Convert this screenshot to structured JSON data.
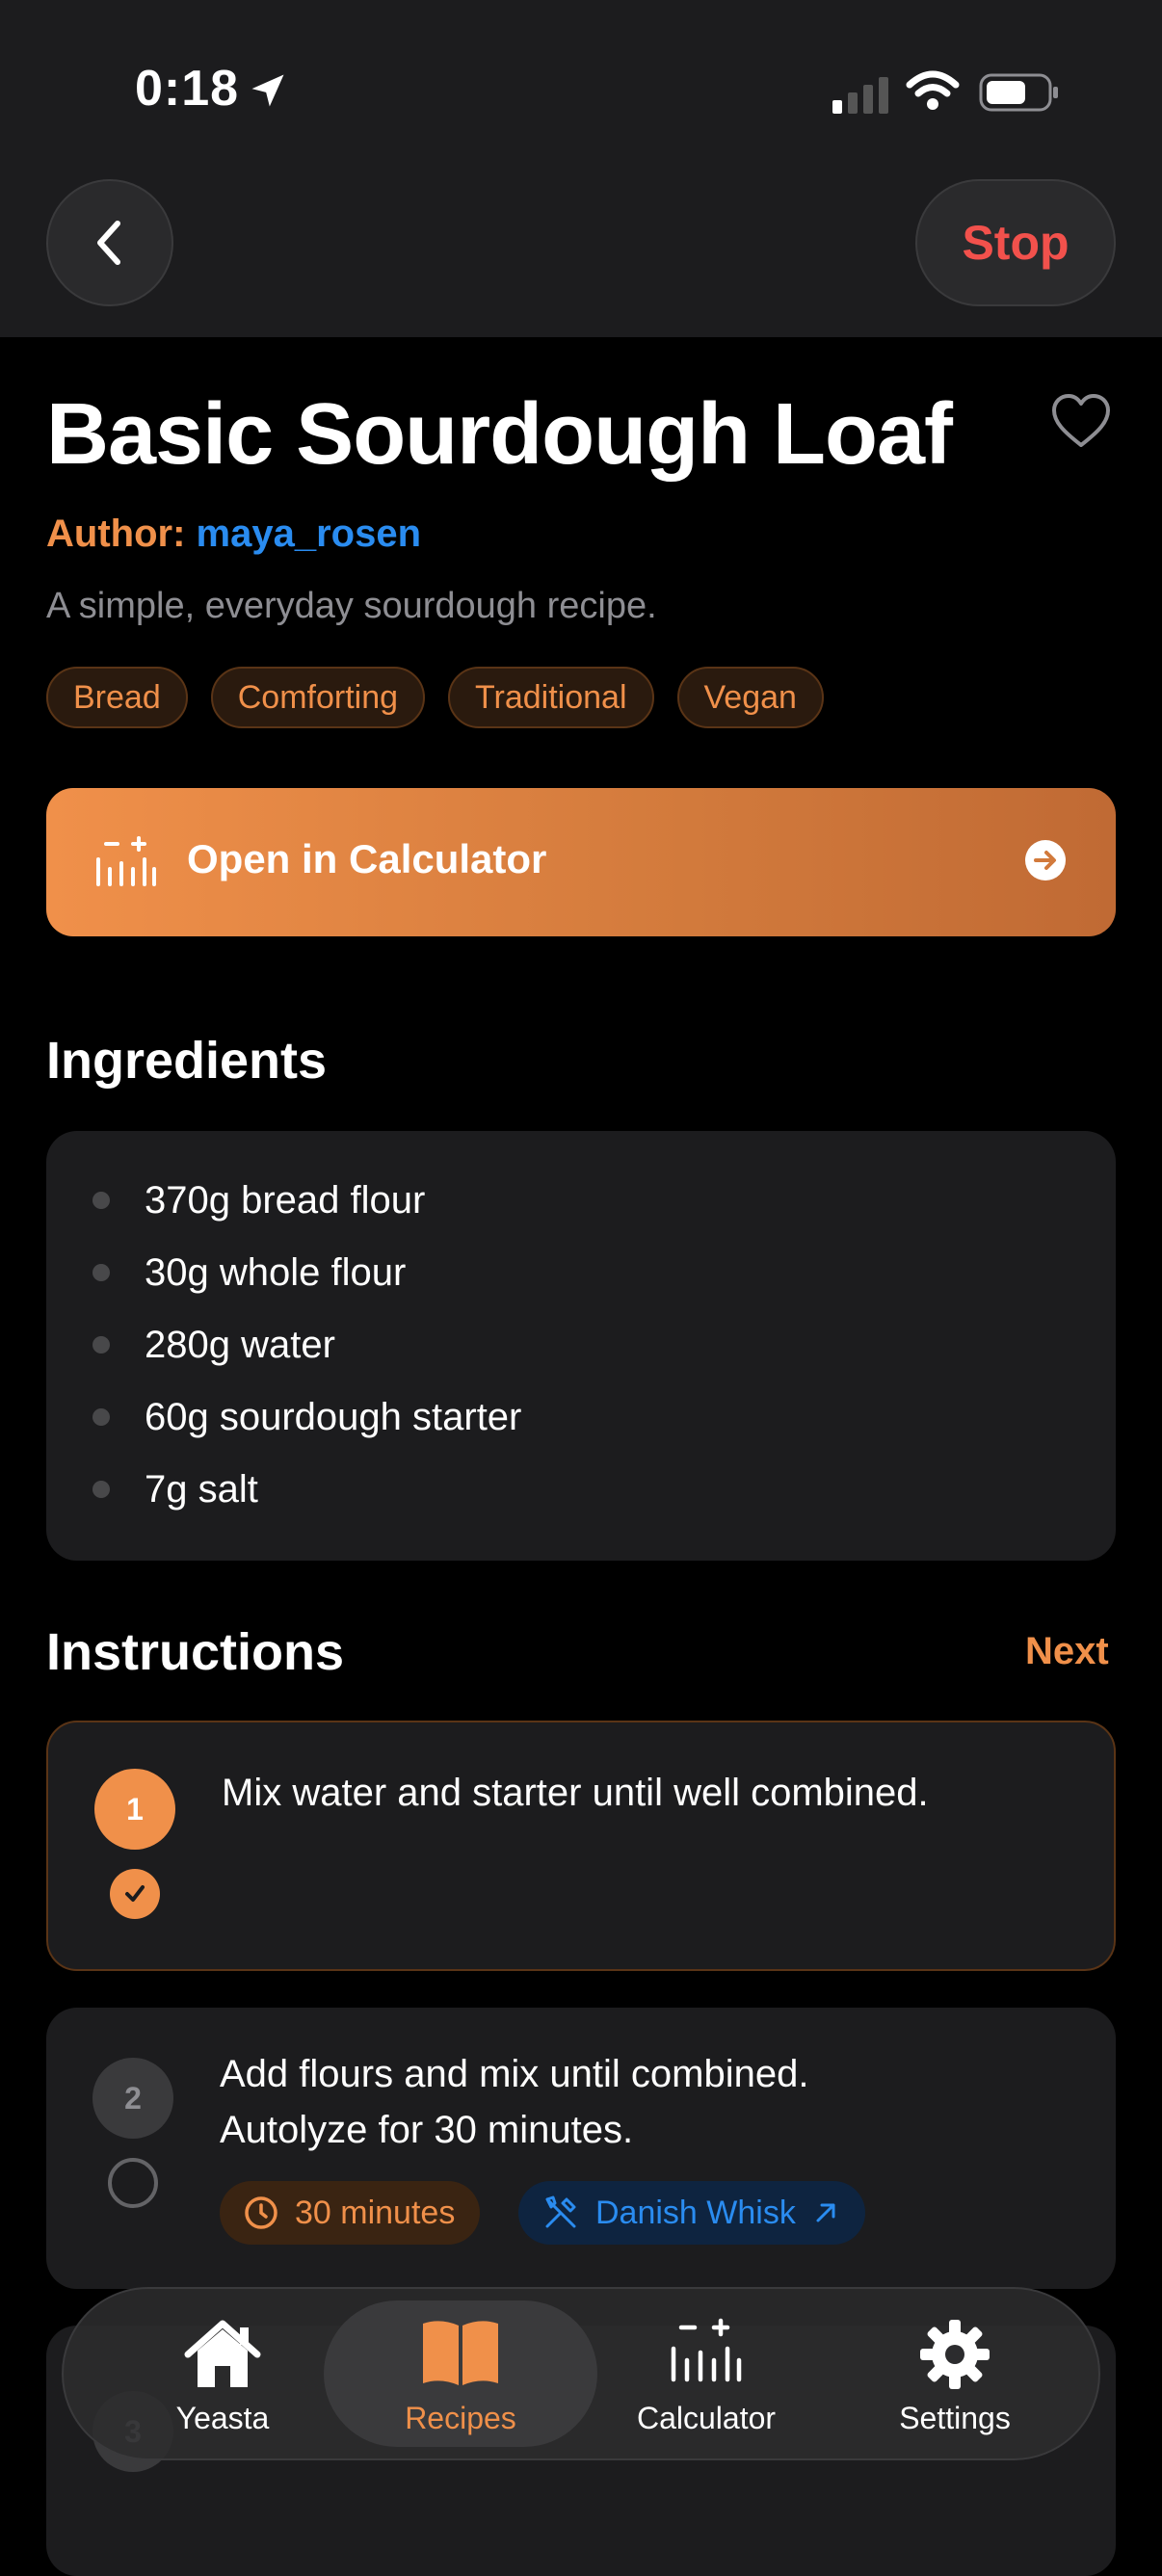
{
  "status": {
    "time": "0:18"
  },
  "nav": {
    "stop_label": "Stop"
  },
  "recipe": {
    "title": "Basic Sourdough Loaf",
    "author_prefix": "Author:",
    "author_name": "maya_rosen",
    "description": "A simple, everyday sourdough recipe.",
    "tags": [
      "Bread",
      "Comforting",
      "Traditional",
      "Vegan"
    ],
    "favorite": false
  },
  "calculator_button": {
    "label": "Open in Calculator"
  },
  "ingredients": {
    "heading": "Ingredients",
    "items": [
      "370g bread flour",
      "30g whole flour",
      "280g water",
      "60g sourdough starter",
      "7g salt"
    ]
  },
  "instructions": {
    "heading": "Instructions",
    "next_label": "Next",
    "steps": [
      {
        "number": "1",
        "text": "Mix water and starter until well combined.",
        "completed": true
      },
      {
        "number": "2",
        "text_line1": "Add flours and mix until combined.",
        "text_line2": "Autolyze for 30 minutes.",
        "completed": false,
        "timer": "30 minutes",
        "tool": "Danish Whisk"
      },
      {
        "number": "3",
        "text": "",
        "completed": false
      }
    ]
  },
  "tabbar": {
    "items": [
      {
        "label": "Yeasta",
        "icon": "home-icon"
      },
      {
        "label": "Recipes",
        "icon": "book-icon",
        "active": true
      },
      {
        "label": "Calculator",
        "icon": "calculator-icon"
      },
      {
        "label": "Settings",
        "icon": "gear-icon"
      }
    ]
  },
  "colors": {
    "accent": "#f0904a",
    "link": "#2a8cf0",
    "danger": "#f2514c",
    "card": "#1c1c1e"
  }
}
